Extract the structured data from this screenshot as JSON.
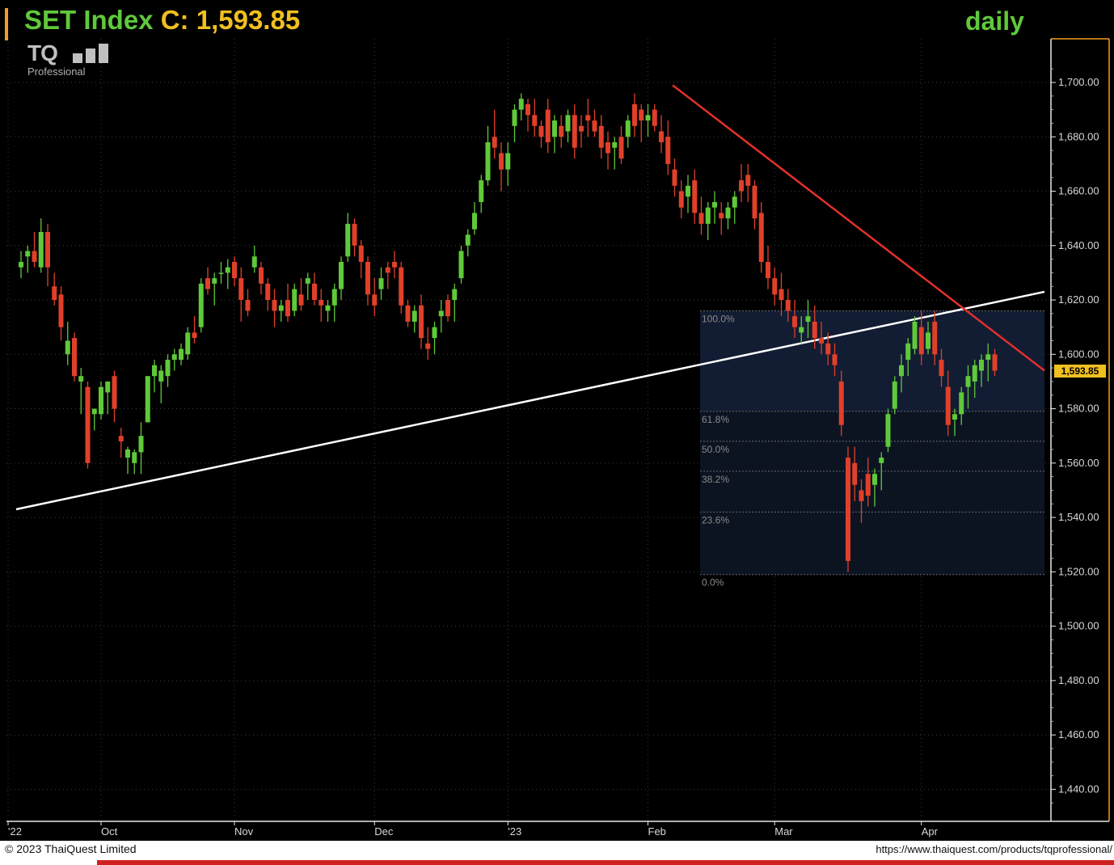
{
  "header": {
    "symbol": "SET Index",
    "close_label": "C:",
    "close_value": "1,593.85",
    "period": "daily"
  },
  "logo": {
    "text": "TQ",
    "subtitle": "Professional"
  },
  "footer": {
    "copyright": "© 2023 ThaiQuest Limited",
    "url": "https://www.thaiquest.com/products/tqprofessional/"
  },
  "colors": {
    "background": "#000000",
    "up_candle": "#5fc93a",
    "down_candle": "#e0402a",
    "trendline_support": "#ffffff",
    "trendline_resistance": "#e0302a",
    "price_tag": "#f0c020",
    "grid": "#3a3a3a"
  },
  "chart_data": {
    "type": "candlestick",
    "title": "SET Index C: 1,593.85",
    "period": "daily",
    "last_price": 1593.85,
    "last_price_label": "1,593.85",
    "ylim": [
      1430,
      1710
    ],
    "y_ticks": [
      1440,
      1460,
      1480,
      1500,
      1520,
      1540,
      1560,
      1580,
      1600,
      1620,
      1640,
      1660,
      1680,
      1700
    ],
    "y_tick_labels": [
      "1,440.00",
      "1,460.00",
      "1,480.00",
      "1,500.00",
      "1,520.00",
      "1,540.00",
      "1,560.00",
      "1,580.00",
      "1,600.00",
      "1,620.00",
      "1,640.00",
      "1,660.00",
      "1,680.00",
      "1,700.00"
    ],
    "x_tick_labels": [
      {
        "label": "'22",
        "index": 0
      },
      {
        "label": "Oct",
        "index": 12
      },
      {
        "label": "Nov",
        "index": 32
      },
      {
        "label": "Dec",
        "index": 53
      },
      {
        "label": "'23",
        "index": 73
      },
      {
        "label": "Feb",
        "index": 94
      },
      {
        "label": "Mar",
        "index": 113
      },
      {
        "label": "Apr",
        "index": 135
      }
    ],
    "grid": true,
    "candles": [
      [
        1632,
        1638,
        1628,
        1634
      ],
      [
        1636,
        1640,
        1630,
        1638
      ],
      [
        1638,
        1645,
        1632,
        1634
      ],
      [
        1632,
        1650,
        1630,
        1645
      ],
      [
        1645,
        1648,
        1625,
        1632
      ],
      [
        1625,
        1630,
        1618,
        1620
      ],
      [
        1622,
        1625,
        1605,
        1610
      ],
      [
        1600,
        1612,
        1596,
        1605
      ],
      [
        1606,
        1608,
        1590,
        1592
      ],
      [
        1590,
        1595,
        1578,
        1592
      ],
      [
        1588,
        1590,
        1558,
        1560
      ],
      [
        1578,
        1580,
        1572,
        1580
      ],
      [
        1578,
        1590,
        1576,
        1588
      ],
      [
        1586,
        1590,
        1578,
        1590
      ],
      [
        1592,
        1594,
        1575,
        1580
      ],
      [
        1570,
        1573,
        1562,
        1568
      ],
      [
        1562,
        1566,
        1556,
        1565
      ],
      [
        1560,
        1565,
        1556,
        1564
      ],
      [
        1564,
        1575,
        1556,
        1570
      ],
      [
        1575,
        1592,
        1575,
        1592
      ],
      [
        1592,
        1598,
        1586,
        1596
      ],
      [
        1590,
        1596,
        1582,
        1594
      ],
      [
        1592,
        1600,
        1588,
        1598
      ],
      [
        1598,
        1602,
        1594,
        1600
      ],
      [
        1598,
        1604,
        1596,
        1602
      ],
      [
        1600,
        1610,
        1598,
        1608
      ],
      [
        1608,
        1614,
        1604,
        1606
      ],
      [
        1610,
        1628,
        1608,
        1626
      ],
      [
        1628,
        1632,
        1622,
        1624
      ],
      [
        1626,
        1630,
        1618,
        1628
      ],
      [
        1630,
        1634,
        1626,
        1630
      ],
      [
        1630,
        1635,
        1624,
        1632
      ],
      [
        1634,
        1636,
        1625,
        1628
      ],
      [
        1628,
        1632,
        1612,
        1620
      ],
      [
        1620,
        1624,
        1614,
        1616
      ],
      [
        1632,
        1640,
        1630,
        1636
      ],
      [
        1632,
        1634,
        1622,
        1626
      ],
      [
        1626,
        1628,
        1616,
        1620
      ],
      [
        1620,
        1624,
        1610,
        1616
      ],
      [
        1616,
        1620,
        1612,
        1618
      ],
      [
        1620,
        1626,
        1612,
        1614
      ],
      [
        1616,
        1626,
        1614,
        1624
      ],
      [
        1622,
        1628,
        1616,
        1618
      ],
      [
        1626,
        1630,
        1620,
        1628
      ],
      [
        1626,
        1630,
        1618,
        1620
      ],
      [
        1620,
        1624,
        1612,
        1618
      ],
      [
        1616,
        1620,
        1612,
        1618
      ],
      [
        1618,
        1626,
        1612,
        1624
      ],
      [
        1624,
        1636,
        1620,
        1634
      ],
      [
        1636,
        1652,
        1634,
        1648
      ],
      [
        1648,
        1650,
        1636,
        1640
      ],
      [
        1640,
        1642,
        1628,
        1634
      ],
      [
        1634,
        1636,
        1618,
        1622
      ],
      [
        1622,
        1628,
        1614,
        1618
      ],
      [
        1624,
        1632,
        1620,
        1628
      ],
      [
        1632,
        1634,
        1624,
        1630
      ],
      [
        1634,
        1638,
        1628,
        1632
      ],
      [
        1632,
        1634,
        1615,
        1618
      ],
      [
        1618,
        1620,
        1610,
        1612
      ],
      [
        1612,
        1618,
        1608,
        1616
      ],
      [
        1618,
        1622,
        1602,
        1606
      ],
      [
        1604,
        1610,
        1598,
        1602
      ],
      [
        1606,
        1612,
        1600,
        1610
      ],
      [
        1614,
        1620,
        1608,
        1616
      ],
      [
        1620,
        1622,
        1612,
        1614
      ],
      [
        1620,
        1626,
        1612,
        1624
      ],
      [
        1628,
        1640,
        1626,
        1638
      ],
      [
        1640,
        1646,
        1636,
        1644
      ],
      [
        1646,
        1656,
        1644,
        1652
      ],
      [
        1656,
        1666,
        1652,
        1664
      ],
      [
        1664,
        1684,
        1662,
        1678
      ],
      [
        1680,
        1690,
        1672,
        1676
      ],
      [
        1674,
        1678,
        1660,
        1668
      ],
      [
        1668,
        1678,
        1662,
        1674
      ],
      [
        1684,
        1692,
        1678,
        1690
      ],
      [
        1690,
        1696,
        1686,
        1694
      ],
      [
        1692,
        1694,
        1682,
        1688
      ],
      [
        1688,
        1694,
        1680,
        1684
      ],
      [
        1684,
        1686,
        1676,
        1680
      ],
      [
        1690,
        1694,
        1674,
        1678
      ],
      [
        1680,
        1688,
        1674,
        1686
      ],
      [
        1684,
        1688,
        1676,
        1680
      ],
      [
        1682,
        1690,
        1678,
        1688
      ],
      [
        1688,
        1692,
        1672,
        1676
      ],
      [
        1684,
        1688,
        1676,
        1682
      ],
      [
        1688,
        1694,
        1680,
        1686
      ],
      [
        1686,
        1690,
        1680,
        1682
      ],
      [
        1684,
        1688,
        1672,
        1676
      ],
      [
        1678,
        1682,
        1668,
        1674
      ],
      [
        1676,
        1680,
        1668,
        1678
      ],
      [
        1680,
        1684,
        1670,
        1672
      ],
      [
        1680,
        1688,
        1676,
        1686
      ],
      [
        1692,
        1696,
        1680,
        1684
      ],
      [
        1690,
        1692,
        1678,
        1686
      ],
      [
        1686,
        1692,
        1680,
        1688
      ],
      [
        1690,
        1692,
        1682,
        1684
      ],
      [
        1682,
        1688,
        1674,
        1678
      ],
      [
        1680,
        1686,
        1666,
        1670
      ],
      [
        1668,
        1672,
        1658,
        1662
      ],
      [
        1660,
        1664,
        1650,
        1654
      ],
      [
        1658,
        1666,
        1652,
        1662
      ],
      [
        1664,
        1668,
        1648,
        1652
      ],
      [
        1652,
        1658,
        1644,
        1648
      ],
      [
        1648,
        1656,
        1642,
        1654
      ],
      [
        1654,
        1660,
        1648,
        1656
      ],
      [
        1652,
        1656,
        1644,
        1650
      ],
      [
        1650,
        1656,
        1646,
        1654
      ],
      [
        1654,
        1660,
        1648,
        1658
      ],
      [
        1664,
        1670,
        1656,
        1660
      ],
      [
        1666,
        1670,
        1656,
        1662
      ],
      [
        1662,
        1664,
        1646,
        1650
      ],
      [
        1652,
        1656,
        1630,
        1634
      ],
      [
        1634,
        1640,
        1624,
        1628
      ],
      [
        1628,
        1632,
        1618,
        1622
      ],
      [
        1624,
        1630,
        1614,
        1620
      ],
      [
        1620,
        1624,
        1612,
        1616
      ],
      [
        1614,
        1620,
        1606,
        1610
      ],
      [
        1608,
        1614,
        1604,
        1610
      ],
      [
        1612,
        1620,
        1606,
        1614
      ],
      [
        1612,
        1618,
        1602,
        1606
      ],
      [
        1606,
        1612,
        1600,
        1604
      ],
      [
        1604,
        1608,
        1596,
        1600
      ],
      [
        1600,
        1604,
        1592,
        1596
      ],
      [
        1590,
        1594,
        1570,
        1574
      ],
      [
        1562,
        1566,
        1520,
        1524
      ],
      [
        1560,
        1566,
        1546,
        1552
      ],
      [
        1550,
        1554,
        1538,
        1546
      ],
      [
        1556,
        1562,
        1544,
        1548
      ],
      [
        1552,
        1558,
        1544,
        1556
      ],
      [
        1560,
        1564,
        1550,
        1562
      ],
      [
        1566,
        1580,
        1564,
        1578
      ],
      [
        1580,
        1592,
        1578,
        1590
      ],
      [
        1592,
        1600,
        1586,
        1596
      ],
      [
        1598,
        1606,
        1592,
        1604
      ],
      [
        1602,
        1614,
        1600,
        1612
      ],
      [
        1610,
        1616,
        1596,
        1600
      ],
      [
        1602,
        1612,
        1600,
        1608
      ],
      [
        1612,
        1616,
        1596,
        1600
      ],
      [
        1598,
        1602,
        1588,
        1592
      ],
      [
        1588,
        1594,
        1570,
        1574
      ],
      [
        1576,
        1580,
        1570,
        1578
      ],
      [
        1578,
        1588,
        1574,
        1586
      ],
      [
        1588,
        1596,
        1580,
        1592
      ],
      [
        1590,
        1598,
        1584,
        1596
      ],
      [
        1594,
        1600,
        1588,
        1598
      ],
      [
        1598,
        1604,
        1590,
        1600
      ],
      [
        1600,
        1602,
        1592,
        1594
      ]
    ],
    "support_line": {
      "from": {
        "index": -1,
        "price": 1543
      },
      "to": {
        "index": 152,
        "price": 1623
      }
    },
    "resistance_line": {
      "from": {
        "index": 100,
        "price": 1699
      },
      "to": {
        "index": 153,
        "price": 1594
      }
    },
    "fibonacci": {
      "high": 1616,
      "low": 1519,
      "levels": [
        {
          "label": "100.0%",
          "price": 1616
        },
        {
          "label": "61.8%",
          "price": 1579
        },
        {
          "label": "50.0%",
          "price": 1568
        },
        {
          "label": "38.2%",
          "price": 1557
        },
        {
          "label": "23.6%",
          "price": 1542
        },
        {
          "label": "0.0%",
          "price": 1519
        }
      ]
    }
  }
}
